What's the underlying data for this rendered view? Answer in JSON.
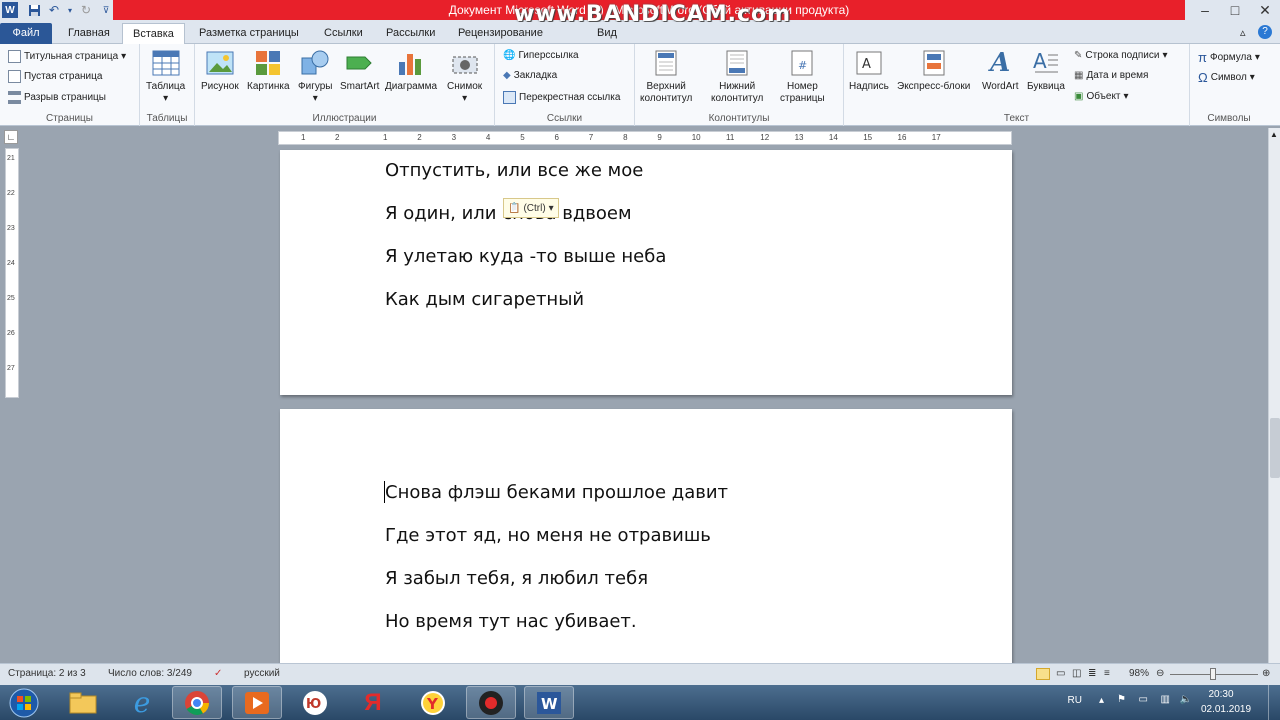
{
  "title_bar": {
    "title": "Документ Microsoft Word (3) - Microsoft Word (Сбой активации продукта)",
    "watermark": "www.BANDICAM.com",
    "minimize": "–",
    "maximize": "□",
    "close": "✕"
  },
  "tabs": [
    "Файл",
    "Главная",
    "Вставка",
    "Разметка страницы",
    "Ссылки",
    "Рассылки",
    "Рецензирование",
    "Вид"
  ],
  "ribbon": {
    "pages": {
      "cover": "Титульная страница",
      "blank": "Пустая страница",
      "break": "Разрыв страницы",
      "label": "Страницы"
    },
    "tables": {
      "table": "Таблица",
      "label": "Таблицы"
    },
    "illustrations": {
      "picture": "Рисунок",
      "clipart": "Картинка",
      "shapes": "Фигуры",
      "smartart": "SmartArt",
      "chart": "Диаграмма",
      "screenshot": "Снимок",
      "label": "Иллюстрации"
    },
    "links": {
      "hyperlink": "Гиперссылка",
      "bookmark": "Закладка",
      "crossref": "Перекрестная ссылка",
      "label": "Ссылки"
    },
    "headerfooter": {
      "header_l1": "Верхний",
      "header_l2": "колонтитул",
      "footer_l1": "Нижний",
      "footer_l2": "колонтитул",
      "pagenum_l1": "Номер",
      "pagenum_l2": "страницы",
      "label": "Колонтитулы"
    },
    "text": {
      "textbox": "Надпись",
      "quickparts": "Экспресс-блоки",
      "wordart": "WordArt",
      "dropcap": "Буквица",
      "sigline": "Строка подписи",
      "datetime": "Дата и время",
      "object": "Объект",
      "label": "Текст"
    },
    "symbols": {
      "equation": "Формула",
      "symbol": "Символ",
      "label": "Символы"
    }
  },
  "ruler_numbers": [
    "1",
    "2",
    "1",
    "2",
    "3",
    "4",
    "5",
    "6",
    "7",
    "8",
    "9",
    "10",
    "11",
    "12",
    "13",
    "14",
    "15",
    "16",
    "17"
  ],
  "vruler_numbers": [
    "21",
    "22",
    "23",
    "24",
    "25",
    "26",
    "27"
  ],
  "paste_options": "(Ctrl)",
  "page1_lines": [
    "Отпустить, или все же мое",
    "Я один, или снова вдвоем",
    "Я улетаю куда -то выше неба",
    "Как дым сигаретный"
  ],
  "page2_lines": [
    "Снова флэш беками прошлое давит",
    "Где этот яд, но меня не отравишь",
    "Я забыл тебя, я любил тебя",
    "Но время тут нас убивает."
  ],
  "status": {
    "page": "Страница: 2 из 3",
    "words": "Число слов: 3/249",
    "language": "русский",
    "zoom": "98%",
    "zoom_fraction": 0.49
  },
  "tray": {
    "lang": "RU",
    "time": "20:30",
    "date": "02.01.2019"
  },
  "colors": {
    "word_blue": "#2b579a",
    "title_red": "#e8202a"
  }
}
